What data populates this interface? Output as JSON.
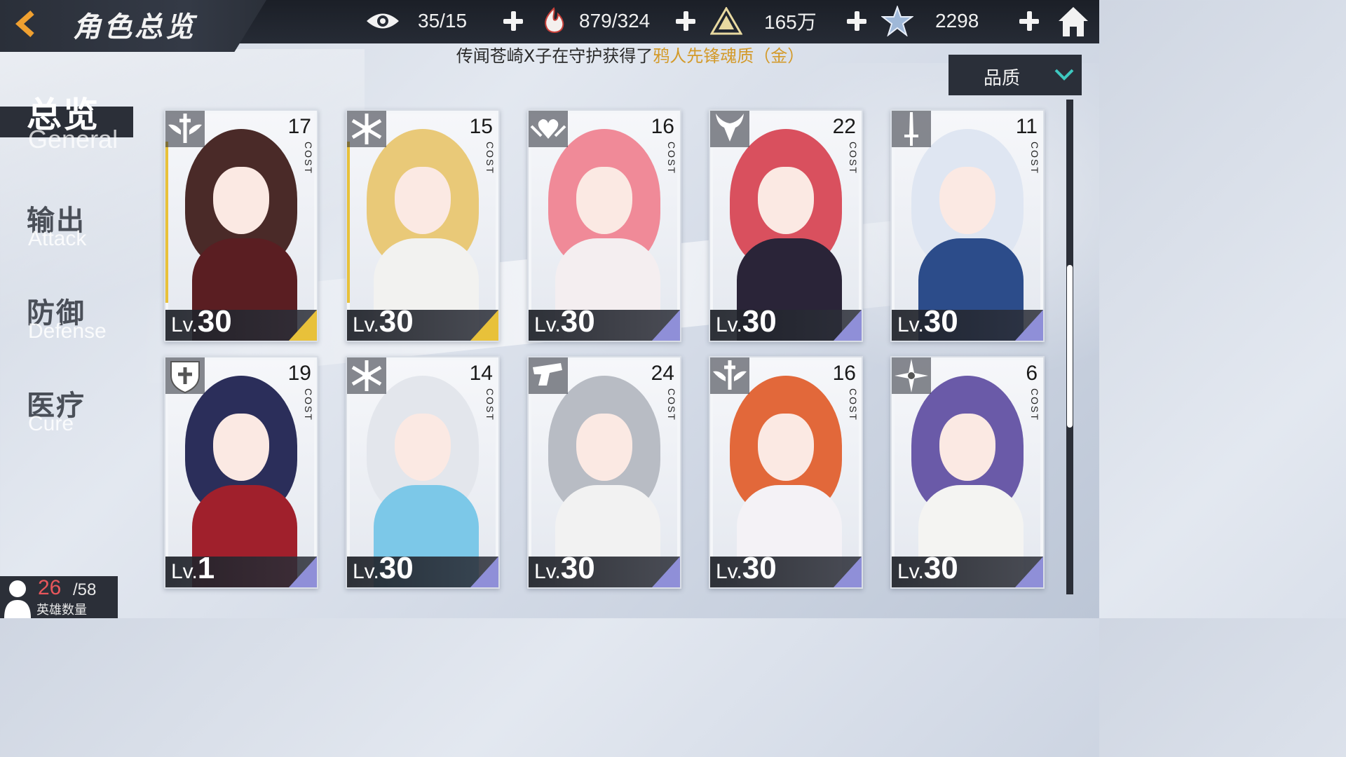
{
  "header": {
    "title": "角色总览",
    "resources": [
      {
        "icon": "eye-icon",
        "value": "35/15"
      },
      {
        "icon": "stamina-flame-icon",
        "value": "879/324"
      },
      {
        "icon": "pyramid-gold-icon",
        "value": "165万"
      },
      {
        "icon": "star-crystal-icon",
        "value": "2298"
      }
    ]
  },
  "ticker": {
    "prefix": "传闻苍崎X子在守护获得了",
    "highlight": "鸦人先锋魂质（金）"
  },
  "sort": {
    "label": "品质"
  },
  "tabs": [
    {
      "zh": "总览",
      "en": "General"
    },
    {
      "zh": "输出",
      "en": "Attack"
    },
    {
      "zh": "防御",
      "en": "Defense"
    },
    {
      "zh": "医疗",
      "en": "Cure"
    }
  ],
  "cards": [
    {
      "class_icon": "winged-sword-icon",
      "cost": "17",
      "cost_label": "COST",
      "lv_prefix": "Lv.",
      "level": "30",
      "tier": "gold",
      "hair": "#4a2a28",
      "outfit": "#5a1e22"
    },
    {
      "class_icon": "snowflake-icon",
      "cost": "15",
      "cost_label": "COST",
      "lv_prefix": "Lv.",
      "level": "30",
      "tier": "gold",
      "hair": "#e9c978",
      "outfit": "#f2f2f0"
    },
    {
      "class_icon": "winged-heart-icon",
      "cost": "16",
      "cost_label": "COST",
      "lv_prefix": "Lv.",
      "level": "30",
      "tier": "purple",
      "hair": "#f08a98",
      "outfit": "#f4eef0"
    },
    {
      "class_icon": "horned-demon-icon",
      "cost": "22",
      "cost_label": "COST",
      "lv_prefix": "Lv.",
      "level": "30",
      "tier": "purple",
      "hair": "#d9505e",
      "outfit": "#2a2438"
    },
    {
      "class_icon": "dagger-icon",
      "cost": "11",
      "cost_label": "COST",
      "lv_prefix": "Lv.",
      "level": "30",
      "tier": "purple",
      "hair": "#dfe6f2",
      "outfit": "#2c4c8a"
    },
    {
      "class_icon": "shield-cross-icon",
      "cost": "19",
      "cost_label": "COST",
      "lv_prefix": "Lv.",
      "level": "1",
      "tier": "purple",
      "hair": "#2b2e5a",
      "outfit": "#a0202c"
    },
    {
      "class_icon": "snowflake-icon",
      "cost": "14",
      "cost_label": "COST",
      "lv_prefix": "Lv.",
      "level": "30",
      "tier": "purple",
      "hair": "#e3e6ec",
      "outfit": "#7cc8e8"
    },
    {
      "class_icon": "pistol-icon",
      "cost": "24",
      "cost_label": "COST",
      "lv_prefix": "Lv.",
      "level": "30",
      "tier": "purple",
      "hair": "#b8bcc4",
      "outfit": "#f2f2f2"
    },
    {
      "class_icon": "winged-sword-icon",
      "cost": "16",
      "cost_label": "COST",
      "lv_prefix": "Lv.",
      "level": "30",
      "tier": "purple",
      "hair": "#e2683a",
      "outfit": "#f4f2f6"
    },
    {
      "class_icon": "shuriken-icon",
      "cost": "6",
      "cost_label": "COST",
      "lv_prefix": "Lv.",
      "level": "30",
      "tier": "purple",
      "hair": "#6a5aa8",
      "outfit": "#f4f4f2"
    }
  ],
  "hero_count": {
    "current": "26",
    "max": "/58",
    "label": "英雄数量"
  },
  "colors": {
    "bar_dark": "#2b2f38",
    "highlight_gold": "#d39a2a",
    "count_red": "#e8565b"
  }
}
